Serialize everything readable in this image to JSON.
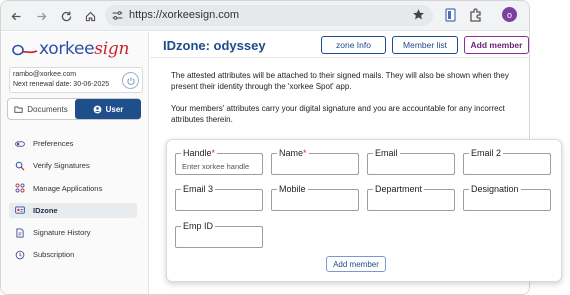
{
  "browser": {
    "url": "https://xorkeesign.com",
    "avatar_letter": "o"
  },
  "brand": {
    "name_part1": "xorkee",
    "name_part2": "sign"
  },
  "account": {
    "email": "rambo@xorkee.com",
    "renewal": "Next renewal date: 30-06-2025"
  },
  "toggle": {
    "documents": "Documents",
    "user": "User"
  },
  "sidebar": {
    "items": [
      {
        "label": "Preferences",
        "icon": "toggle-icon"
      },
      {
        "label": "Verify Signatures",
        "icon": "search-icon"
      },
      {
        "label": "Manage Applications",
        "icon": "apps-icon"
      },
      {
        "label": "IDzone",
        "icon": "id-card-icon"
      },
      {
        "label": "Signature History",
        "icon": "document-icon"
      },
      {
        "label": "Subscription",
        "icon": "subscription-icon"
      }
    ]
  },
  "header": {
    "title": "IDzone: odyssey",
    "zone_info": "zone Info",
    "member_list": "Member list",
    "add_member": "Add member"
  },
  "main": {
    "para1": "The attested attributes will be attached to their signed mails. They will also be shown when they present their identity through the 'xorkee Spot' app.",
    "para2": "Your members' attributes carry your digital signature and you are accountable for any incorrect attributes therein."
  },
  "form": {
    "fields": [
      {
        "label": "Handle",
        "required": "*",
        "placeholder": "Enter xorkee handle"
      },
      {
        "label": "Name",
        "required": "*",
        "placeholder": ""
      },
      {
        "label": "Email",
        "required": "",
        "placeholder": ""
      },
      {
        "label": "Email 2",
        "required": "",
        "placeholder": ""
      },
      {
        "label": "Email 3",
        "required": "",
        "placeholder": ""
      },
      {
        "label": "Mobile",
        "required": "",
        "placeholder": ""
      },
      {
        "label": "Department",
        "required": "",
        "placeholder": ""
      },
      {
        "label": "Designation",
        "required": "",
        "placeholder": ""
      },
      {
        "label": "Emp ID",
        "required": "",
        "placeholder": ""
      }
    ],
    "submit": "Add member"
  },
  "colors": {
    "accent": "#1e4c8c",
    "brand_red": "#c9262c",
    "primary_button": "#8a2f9a"
  }
}
